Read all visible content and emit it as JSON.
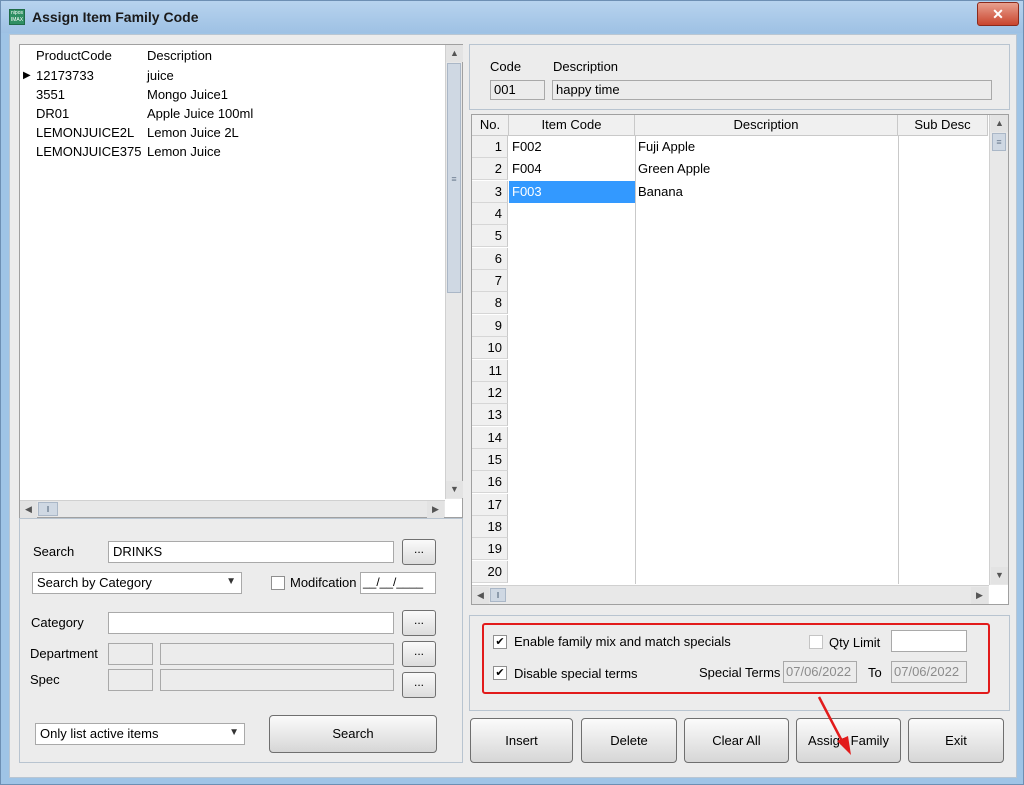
{
  "window": {
    "title": "Assign Item Family Code",
    "app_icon": "nipos-app-icon",
    "close_glyph": "✕"
  },
  "product_grid": {
    "headers": [
      "ProductCode",
      "Description"
    ],
    "rows": [
      {
        "code": "12173733",
        "desc": "juice",
        "selected": true
      },
      {
        "code": "3551",
        "desc": "Mongo Juice1"
      },
      {
        "code": "DR01",
        "desc": "Apple Juice 100ml"
      },
      {
        "code": "LEMONJUICE2L",
        "desc": "Lemon Juice 2L"
      },
      {
        "code": "LEMONJUICE375",
        "desc": "Lemon Juice"
      }
    ],
    "row_marker": "▶"
  },
  "search_panel": {
    "search_label": "Search",
    "search_value": "DRINKS",
    "dots_label": "...",
    "search_by": "Search by Category",
    "modification_label": "Modifcation",
    "modification_date": "__/__/____",
    "category_label": "Category",
    "department_label": "Department",
    "spec_label": "Spec",
    "list_filter": "Only list active items",
    "search_button": "Search"
  },
  "family_header": {
    "code_label": "Code",
    "desc_label": "Description",
    "code_value": "001",
    "desc_value": "happy time"
  },
  "item_grid": {
    "headers": [
      "No.",
      "Item Code",
      "Description",
      "Sub Desc"
    ],
    "rows": [
      {
        "no": "1",
        "code": "F002",
        "desc": "Fuji Apple"
      },
      {
        "no": "2",
        "code": "F004",
        "desc": "Green Apple"
      },
      {
        "no": "3",
        "code": "F003",
        "desc": "Banana"
      },
      {
        "no": "4",
        "code": "",
        "desc": ""
      },
      {
        "no": "5",
        "code": "",
        "desc": ""
      },
      {
        "no": "6",
        "code": "",
        "desc": ""
      },
      {
        "no": "7",
        "code": "",
        "desc": ""
      },
      {
        "no": "8",
        "code": "",
        "desc": ""
      },
      {
        "no": "9",
        "code": "",
        "desc": ""
      },
      {
        "no": "10",
        "code": "",
        "desc": ""
      },
      {
        "no": "11",
        "code": "",
        "desc": ""
      },
      {
        "no": "12",
        "code": "",
        "desc": ""
      },
      {
        "no": "13",
        "code": "",
        "desc": ""
      },
      {
        "no": "14",
        "code": "",
        "desc": ""
      },
      {
        "no": "15",
        "code": "",
        "desc": ""
      },
      {
        "no": "16",
        "code": "",
        "desc": ""
      },
      {
        "no": "17",
        "code": "",
        "desc": ""
      },
      {
        "no": "18",
        "code": "",
        "desc": ""
      },
      {
        "no": "19",
        "code": "",
        "desc": ""
      },
      {
        "no": "20",
        "code": "",
        "desc": ""
      }
    ]
  },
  "options": {
    "enable_mix_label": "Enable family mix and match specials",
    "enable_mix_checked": true,
    "qty_limit_label": "Qty Limit",
    "qty_limit_checked": false,
    "qty_limit_value": "",
    "disable_terms_label": "Disable special terms",
    "disable_terms_checked": true,
    "special_terms_label": "Special Terms",
    "special_from": "07/06/2022",
    "to_label": "To",
    "special_to": "07/06/2022",
    "highlight_color": "#e21b1b"
  },
  "actions": {
    "insert": "Insert",
    "delete": "Delete",
    "clear_all": "Clear All",
    "assign_family": "Assign Family",
    "exit": "Exit"
  },
  "scroll": {
    "up": "▲",
    "down": "▼",
    "left": "◀",
    "right": "▶",
    "grip": "≡",
    "hgrip": "‖"
  },
  "checkmark": "✔",
  "dropdown_arrow": "▼"
}
